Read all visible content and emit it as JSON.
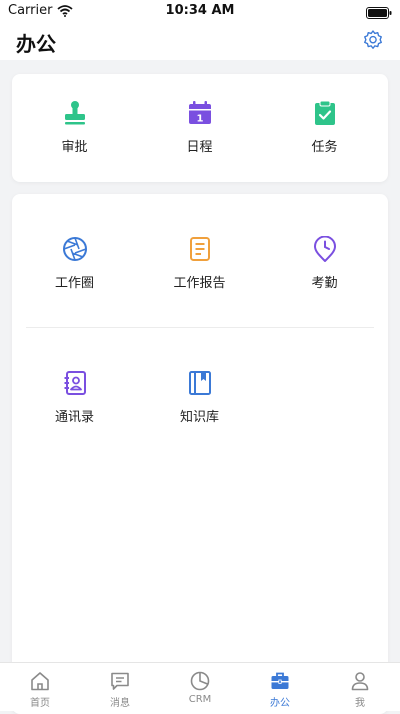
{
  "status_bar": {
    "carrier": "Carrier",
    "time": "10:34 AM"
  },
  "header": {
    "title": "办公"
  },
  "card1": {
    "items": [
      {
        "label": "审批",
        "icon": "stamp-icon",
        "color": "#2ec48a"
      },
      {
        "label": "日程",
        "icon": "calendar-icon",
        "color": "#7a4fe0"
      },
      {
        "label": "任务",
        "icon": "clipboard-check-icon",
        "color": "#2ec48a"
      }
    ]
  },
  "card2": {
    "items": [
      {
        "label": "工作圈",
        "icon": "aperture-icon",
        "color": "#3b79d6"
      },
      {
        "label": "工作报告",
        "icon": "report-icon",
        "color": "#f0a03c"
      },
      {
        "label": "考勤",
        "icon": "location-clock-icon",
        "color": "#7a4fe0"
      },
      {
        "label": "通讯录",
        "icon": "contacts-icon",
        "color": "#7a4fe0"
      },
      {
        "label": "知识库",
        "icon": "book-icon",
        "color": "#3b79d6"
      }
    ]
  },
  "tabs": [
    {
      "label": "首页",
      "icon": "home-icon",
      "active": false
    },
    {
      "label": "消息",
      "icon": "message-icon",
      "active": false
    },
    {
      "label": "CRM",
      "icon": "pie-chart-icon",
      "active": false
    },
    {
      "label": "办公",
      "icon": "briefcase-icon",
      "active": true
    },
    {
      "label": "我",
      "icon": "profile-icon",
      "active": false
    }
  ],
  "colors": {
    "accent": "#3b79d6",
    "inactive": "#8a8a8a"
  }
}
